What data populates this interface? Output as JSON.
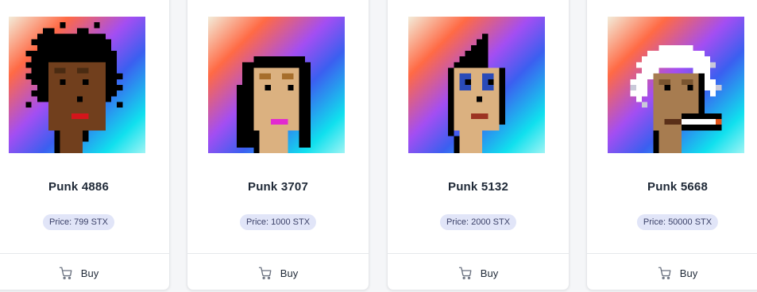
{
  "buy_label": "Buy",
  "cards": [
    {
      "name": "Punk 4886",
      "price": "Price: 799 STX",
      "avatar": "punk-avatar-dark-skin-afro"
    },
    {
      "name": "Punk 3707",
      "price": "Price: 1000 STX",
      "avatar": "punk-avatar-long-hair"
    },
    {
      "name": "Punk 5132",
      "price": "Price: 2000 STX",
      "avatar": "punk-avatar-mohawk"
    },
    {
      "name": "Punk 5668",
      "price": "Price: 50000 STX",
      "avatar": "punk-avatar-white-hair-cigarette"
    }
  ],
  "colors": {
    "price_badge_bg": "#e1e5f8",
    "card_border": "#e6e8eb",
    "gradient": [
      "#f0e8d8",
      "#ff6a45",
      "#9b4ff0",
      "#3b63f0",
      "#14e6f0"
    ]
  }
}
